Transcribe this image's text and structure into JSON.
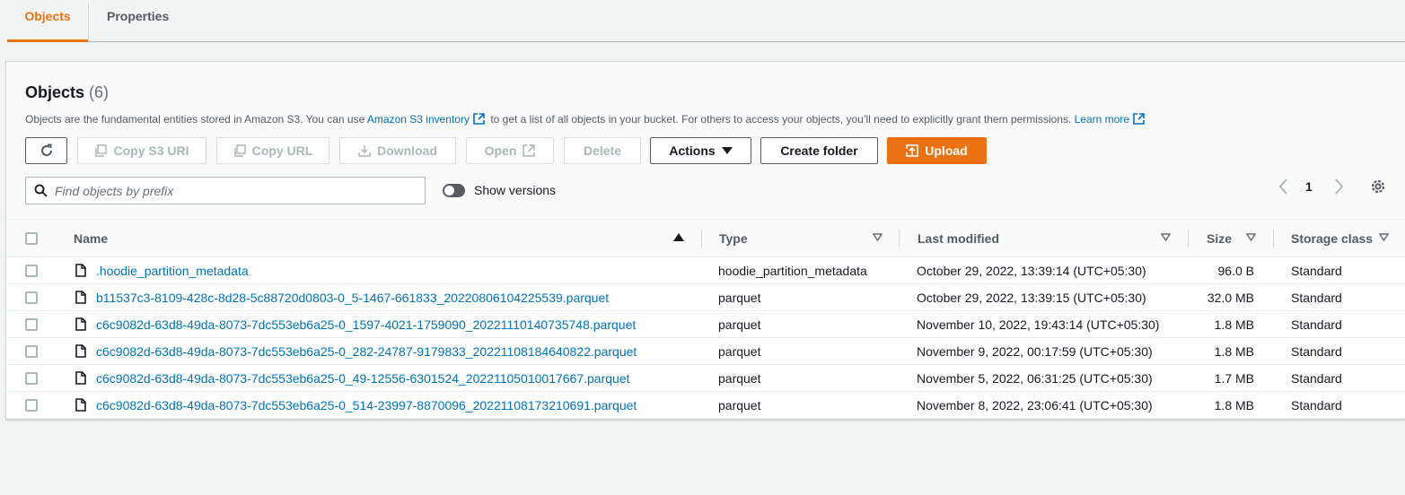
{
  "tabs": [
    {
      "label": "Objects",
      "active": true
    },
    {
      "label": "Properties",
      "active": false
    }
  ],
  "header": {
    "title": "Objects",
    "count": "(6)",
    "desc_part1": "Objects are the fundamental entities stored in Amazon S3. You can use ",
    "inventory_link": "Amazon S3 inventory",
    "desc_part2": " to get a list of all objects in your bucket. For others to access your objects, you’ll need to explicitly grant them permissions. ",
    "learn_more": "Learn more"
  },
  "toolbar": {
    "copy_s3_uri": "Copy S3 URI",
    "copy_url": "Copy URL",
    "download": "Download",
    "open": "Open",
    "delete": "Delete",
    "actions": "Actions",
    "create_folder": "Create folder",
    "upload": "Upload"
  },
  "search": {
    "placeholder": "Find objects by prefix",
    "value": ""
  },
  "show_versions": {
    "label": "Show versions",
    "on": false
  },
  "pagination": {
    "page": "1"
  },
  "columns": {
    "name": "Name",
    "type": "Type",
    "last_modified": "Last modified",
    "size": "Size",
    "storage_class": "Storage class"
  },
  "rows": [
    {
      "name": ".hoodie_partition_metadata",
      "type": "hoodie_partition_metadata",
      "last_modified": "October 29, 2022, 13:39:14 (UTC+05:30)",
      "size": "96.0 B",
      "storage_class": "Standard"
    },
    {
      "name": "b11537c3-8109-428c-8d28-5c88720d0803-0_5-1467-661833_20220806104225539.parquet",
      "type": "parquet",
      "last_modified": "October 29, 2022, 13:39:15 (UTC+05:30)",
      "size": "32.0 MB",
      "storage_class": "Standard"
    },
    {
      "name": "c6c9082d-63d8-49da-8073-7dc553eb6a25-0_1597-4021-1759090_20221110140735748.parquet",
      "type": "parquet",
      "last_modified": "November 10, 2022, 19:43:14 (UTC+05:30)",
      "size": "1.8 MB",
      "storage_class": "Standard"
    },
    {
      "name": "c6c9082d-63d8-49da-8073-7dc553eb6a25-0_282-24787-9179833_20221108184640822.parquet",
      "type": "parquet",
      "last_modified": "November 9, 2022, 00:17:59 (UTC+05:30)",
      "size": "1.8 MB",
      "storage_class": "Standard"
    },
    {
      "name": "c6c9082d-63d8-49da-8073-7dc553eb6a25-0_49-12556-6301524_20221105010017667.parquet",
      "type": "parquet",
      "last_modified": "November 5, 2022, 06:31:25 (UTC+05:30)",
      "size": "1.7 MB",
      "storage_class": "Standard"
    },
    {
      "name": "c6c9082d-63d8-49da-8073-7dc553eb6a25-0_514-23997-8870096_20221108173210691.parquet",
      "type": "parquet",
      "last_modified": "November 8, 2022, 23:06:41 (UTC+05:30)",
      "size": "1.8 MB",
      "storage_class": "Standard"
    }
  ],
  "colors": {
    "accent": "#ec7211",
    "link": "#0073bb"
  }
}
